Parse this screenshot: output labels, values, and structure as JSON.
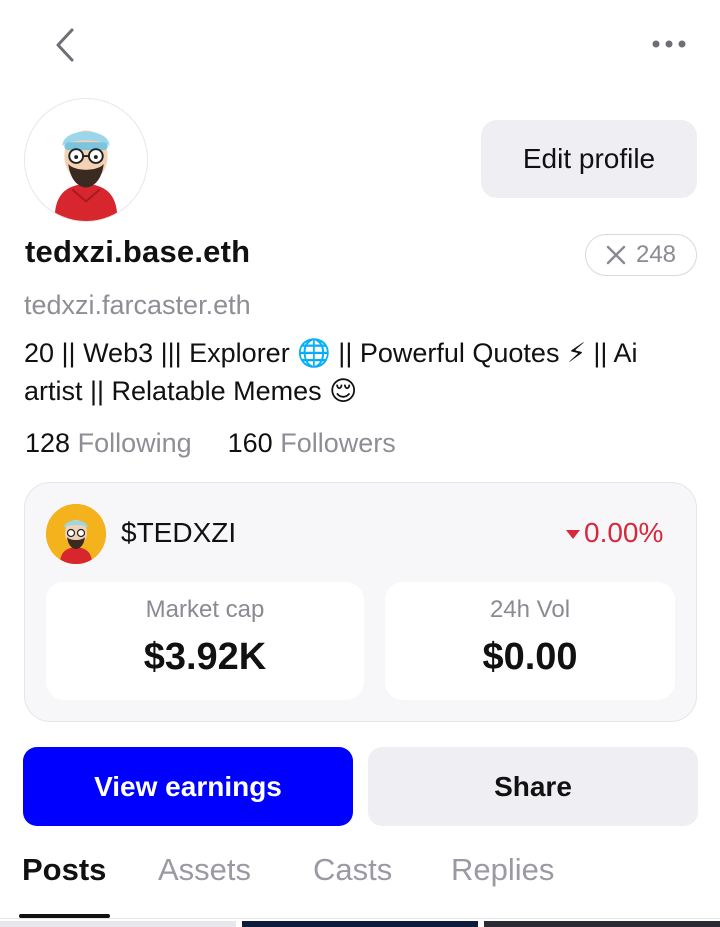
{
  "header": {
    "back_icon": "chevron-left-icon",
    "more_icon": "more-horizontal-icon"
  },
  "profile": {
    "display_name": "tedxzi.base.eth",
    "username": "tedxzi.farcaster.eth",
    "bio": "20 || Web3 ||| Explorer 🌐 || Powerful Quotes ⚡ || Ai artist || Relatable Memes 😌",
    "edit_label": "Edit profile",
    "x_count": "248",
    "following_count": "128",
    "following_label": "Following",
    "followers_count": "160",
    "followers_label": "Followers"
  },
  "token": {
    "symbol": "$TEDXZI",
    "change": "0.00%",
    "change_direction": "down",
    "market_cap_label": "Market cap",
    "market_cap_value": "$3.92K",
    "volume_label": "24h Vol",
    "volume_value": "$0.00"
  },
  "actions": {
    "earnings_label": "View earnings",
    "share_label": "Share"
  },
  "tabs": [
    {
      "label": "Posts",
      "active": true
    },
    {
      "label": "Assets",
      "active": false
    },
    {
      "label": "Casts",
      "active": false
    },
    {
      "label": "Replies",
      "active": false
    }
  ],
  "colors": {
    "primary": "#0000ff",
    "negative": "#d6293b",
    "muted": "#8e8e96",
    "surface": "#efeff3"
  }
}
